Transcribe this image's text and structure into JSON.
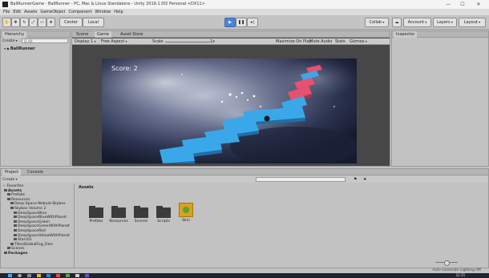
{
  "window": {
    "title": "BallRunnerGame - BallRunner - PC, Mac & Linux Standalone - Unity 2019.1.0f2 Personal <DX11>",
    "controls": [
      "—",
      "☐",
      "✕"
    ]
  },
  "menu": [
    "File",
    "Edit",
    "Assets",
    "GameObject",
    "Component",
    "Window",
    "Help"
  ],
  "toolbar": {
    "center_label": "Center",
    "local_label": "Local",
    "collab_label": "Collab",
    "account_label": "Account",
    "layers_label": "Layers",
    "layout_label": "Layout"
  },
  "hierarchy": {
    "tab": "Hierarchy",
    "create_label": "Create",
    "search_placeholder": "Q All",
    "scene_item": "BallRunner"
  },
  "center_tabs": {
    "scene": "Scene",
    "game": "Game",
    "asset_store": "Asset Store"
  },
  "game_toolbar": {
    "display": "Display 1",
    "aspect": "Free Aspect",
    "scale_label": "Scale",
    "scale_value": "1x",
    "maximize": "Maximize On Play",
    "mute": "Mute Audio",
    "stats": "Stats",
    "gizmos": "Gizmos"
  },
  "game": {
    "score_text": "Score: 2"
  },
  "inspector": {
    "tab": "Inspector"
  },
  "project": {
    "tabs": [
      "Project",
      "Console"
    ],
    "create_label": "Create",
    "favorites": "Favorites",
    "assets_path": "Assets",
    "tree": [
      {
        "label": "Assets",
        "level": 0,
        "bold": true
      },
      {
        "label": "Prefabs",
        "level": 1
      },
      {
        "label": "Resources",
        "level": 1
      },
      {
        "label": "Deep-Space-Nebula-Skybox",
        "level": 2
      },
      {
        "label": "Skybox Volume 2",
        "level": 2
      },
      {
        "label": "DeepSpaceBlue",
        "level": 3
      },
      {
        "label": "DeepSpaceBlueWithPlanet",
        "level": 3
      },
      {
        "label": "DeepSpaceGreen",
        "level": 3
      },
      {
        "label": "DeepSpaceGreenWithPlanet",
        "level": 3
      },
      {
        "label": "DeepSpaceRed",
        "level": 3
      },
      {
        "label": "DeepSpaceYellowWithPlanet",
        "level": 3
      },
      {
        "label": "Stars01",
        "level": 3
      },
      {
        "label": "TiltedGlobalFog_Files",
        "level": 2
      },
      {
        "label": "Scenes",
        "level": 1
      },
      {
        "label": "Packages",
        "level": 0,
        "bold": true
      }
    ],
    "tiles": [
      {
        "label": "Prefabs",
        "kind": "folder"
      },
      {
        "label": "Resources",
        "kind": "folder"
      },
      {
        "label": "Scenes",
        "kind": "folder"
      },
      {
        "label": "Scripts",
        "kind": "folder"
      },
      {
        "label": "Skin",
        "kind": "scene"
      }
    ]
  },
  "status": {
    "text": "Auto Generate Lighting Off"
  },
  "taskbar": {
    "clock": "22:35"
  },
  "colors": {
    "play_active": "#4a85d6",
    "platform_blue": "#3aa8e8",
    "platform_pink": "#e8506f",
    "ball": "#1a1a1a"
  }
}
